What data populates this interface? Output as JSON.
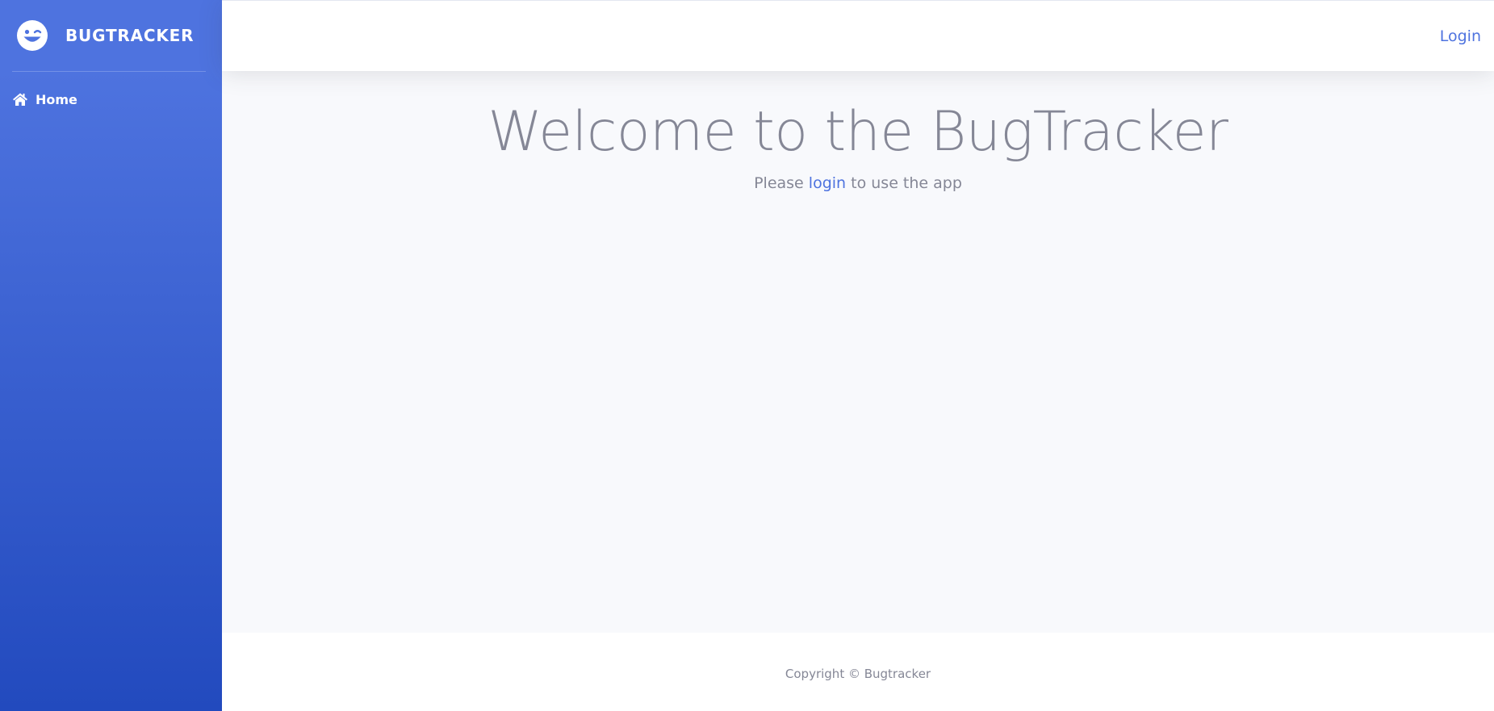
{
  "sidebar": {
    "brand": {
      "icon": "grin-wink-icon",
      "name": "BUGTRACKER"
    },
    "items": [
      {
        "icon": "home-icon",
        "label": "Home"
      }
    ]
  },
  "topbar": {
    "login_label": "Login"
  },
  "main": {
    "title": "Welcome to the BugTracker",
    "subtitle_before": "Please ",
    "subtitle_link": "login",
    "subtitle_after": " to use the app"
  },
  "footer": {
    "copyright": "Copyright © Bugtracker"
  },
  "colors": {
    "primary": "#4e73df",
    "primary_dark": "#224abe",
    "text_muted": "#858796",
    "background": "#f8f9fc"
  }
}
